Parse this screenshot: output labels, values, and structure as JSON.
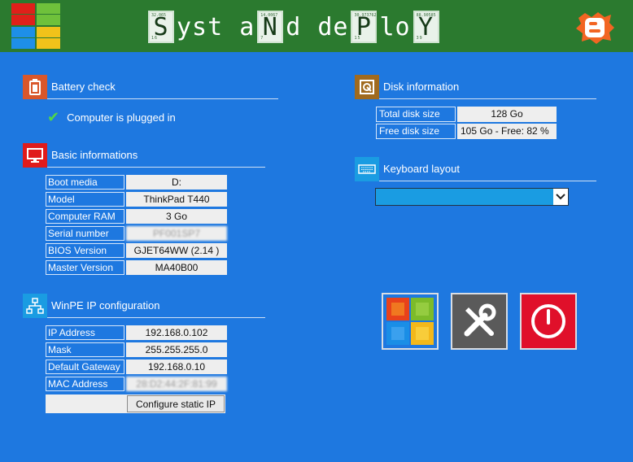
{
  "header": {
    "title_parts": {
      "p1": "S",
      "p2": "yst",
      "p3": "a",
      "p4": "N",
      "p5": "d",
      "p6": "de",
      "p7": "P",
      "p8": "lo",
      "p9": "Y"
    },
    "tile_numbers": {
      "t1_top": "32.065",
      "t1_bottom": "16",
      "t2_top": "14.0067",
      "t2_bottom": "7",
      "t3_top": "30.973762",
      "t3_bottom": "15",
      "t4_top": "88.90585",
      "t4_bottom": "39"
    }
  },
  "battery": {
    "title": "Battery check",
    "status": "Computer is plugged in"
  },
  "basic": {
    "title": "Basic informations",
    "rows": [
      {
        "label": "Boot media",
        "value": "D:"
      },
      {
        "label": "Model",
        "value": "ThinkPad T440"
      },
      {
        "label": "Computer RAM",
        "value": "3 Go"
      },
      {
        "label": "Serial number",
        "value": "PF001SP7"
      },
      {
        "label": "BIOS Version",
        "value": "GJET64WW (2.14 )"
      },
      {
        "label": "Master Version",
        "value": "MA40B00"
      }
    ]
  },
  "ip": {
    "title": "WinPE IP configuration",
    "rows": [
      {
        "label": "IP Address",
        "value": "192.168.0.102"
      },
      {
        "label": "Mask",
        "value": "255.255.255.0"
      },
      {
        "label": "Default Gateway",
        "value": "192.168.0.10"
      },
      {
        "label": "MAC Address",
        "value": "28:D2:44:2F:81:99"
      }
    ],
    "button": "Configure static IP"
  },
  "disk": {
    "title": "Disk information",
    "rows": [
      {
        "label": "Total disk size",
        "value": "128 Go"
      },
      {
        "label": "Free disk size",
        "value": "105 Go - Free: 82 %"
      }
    ]
  },
  "keyboard": {
    "title": "Keyboard layout",
    "selected": ""
  },
  "icons": {
    "battery": "battery-icon",
    "check": "checkmark-icon",
    "monitor": "monitor-icon",
    "network": "network-icon",
    "disk": "disk-icon",
    "keyboard": "keyboard-icon",
    "windows": "windows-logo-icon",
    "tools": "tools-icon",
    "power": "power-icon",
    "blogger": "blogger-icon"
  },
  "colors": {
    "background": "#1e78e0",
    "header": "#2b7a2f",
    "battery_icon_bg": "#d9572b",
    "monitor_icon_bg": "#e01b1b",
    "network_icon_bg": "#1a9ce2",
    "disk_icon_bg": "#a06a1e",
    "keyboard_icon_bg": "#1a9ce2",
    "tools_bg": "#5a5a5a",
    "power_bg": "#e0102a"
  }
}
